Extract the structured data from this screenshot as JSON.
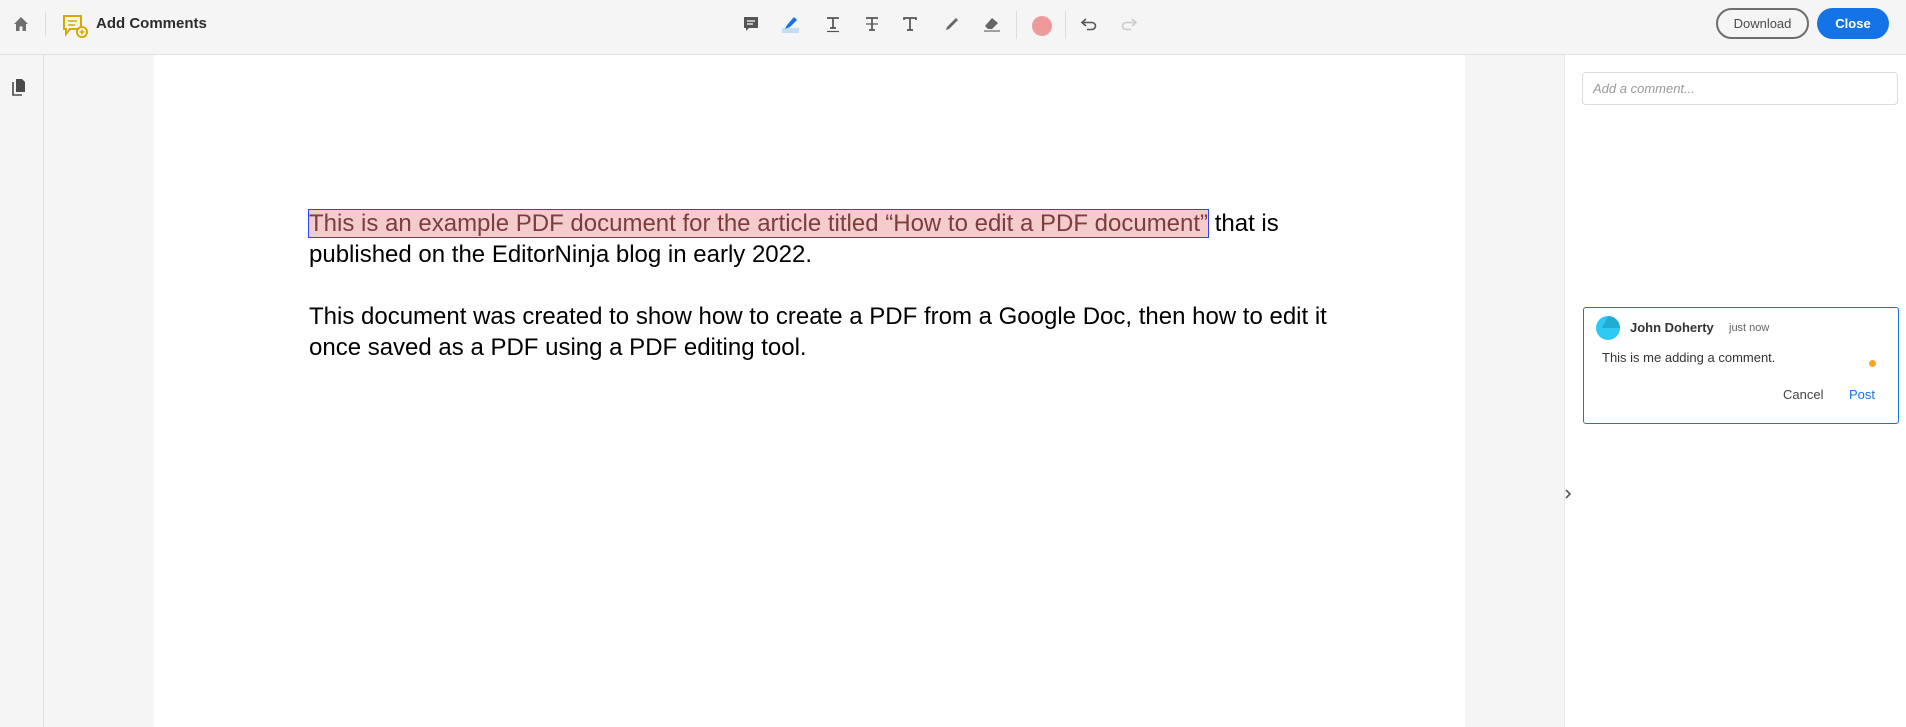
{
  "header": {
    "title": "Add Comments",
    "download_label": "Download",
    "close_label": "Close"
  },
  "toolbar": {
    "tools": [
      "comment-icon",
      "highlight-icon",
      "underline-icon",
      "strikethrough-icon",
      "add-text-icon",
      "pencil-icon",
      "eraser-icon"
    ],
    "color": "#ee9a9a",
    "accent": "#1473e6"
  },
  "document": {
    "highlighted": "This is an example PDF document for the article titled “How to edit a PDF document”",
    "line1_rest": " that is",
    "line2": "published on the EditorNinja blog in early 2022.",
    "line3": "This document was created to show how to create a PDF from a Google Doc, then how to edit it",
    "line4": "once saved as a PDF using a PDF editing tool."
  },
  "comments": {
    "placeholder": "Add a comment...",
    "card": {
      "author": "John Doherty",
      "time": "just now",
      "text": "This is me adding a comment.",
      "cancel": "Cancel",
      "post": "Post"
    }
  }
}
